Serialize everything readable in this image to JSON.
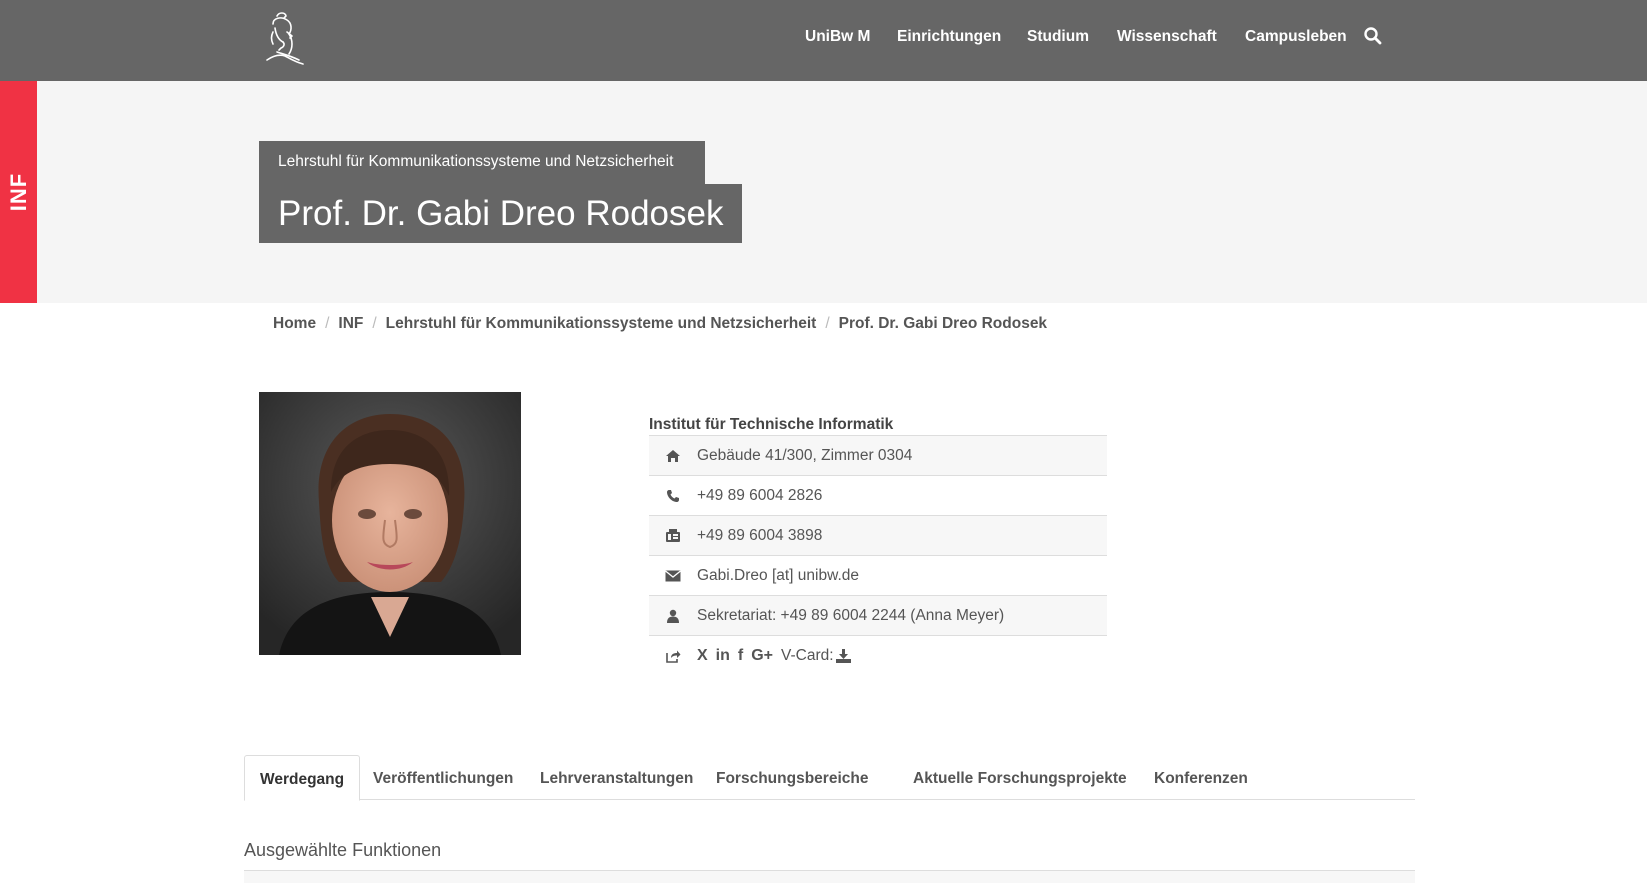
{
  "nav": {
    "logo_icon": "university-helmet-logo-icon",
    "items": [
      "UniBw M",
      "Einrichtungen",
      "Studium",
      "Wissenschaft",
      "Campusleben"
    ],
    "search_icon": "search-icon"
  },
  "side_tab": {
    "label": "INF"
  },
  "header": {
    "subtitle": "Lehrstuhl für Kommunikationssysteme und Netzsicherheit",
    "title": "Prof. Dr. Gabi Dreo Rodosek"
  },
  "breadcrumb": {
    "items": [
      "Home",
      "INF",
      "Lehrstuhl für Kommunikationssysteme und Netzsicherheit",
      "Prof. Dr. Gabi Dreo Rodosek"
    ],
    "separator": "/"
  },
  "contact": {
    "institute": "Institut für Technische Informatik",
    "room": "Gebäude 41/300, Zimmer 0304",
    "phone": "+49 89 6004 2826",
    "fax": "+49 89 6004 3898",
    "email": "Gabi.Dreo [at] unibw.de",
    "secretary": "Sekretariat: +49 89 6004 2244 (Anna Meyer)",
    "social": {
      "xing": "X",
      "linkedin": "in",
      "facebook": "f",
      "googleplus": "G+",
      "vcard_label": "V-Card:"
    }
  },
  "tabs": [
    "Werdegang",
    "Veröffentlichungen",
    "Lehrveranstaltungen",
    "Forschungsbereiche",
    "Aktuelle Forschungsprojekte",
    "Konferenzen"
  ],
  "section": {
    "title": "Ausgewählte Funktionen"
  },
  "colors": {
    "navbar": "#666666",
    "accent": "#f03244",
    "hero_bg": "#f5f5f5"
  }
}
